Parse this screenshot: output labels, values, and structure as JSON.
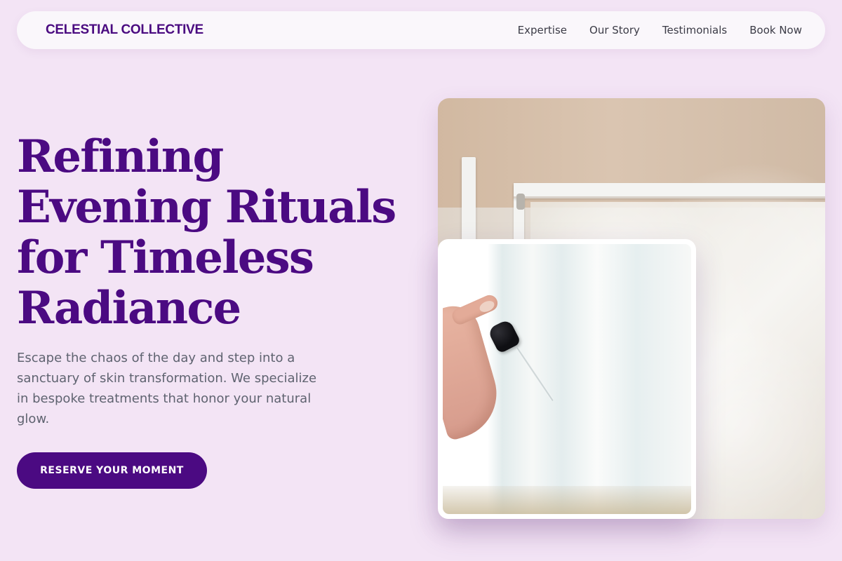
{
  "navigation": {
    "brand": "CELESTIAL COLLECTIVE",
    "links": [
      {
        "label": "Expertise"
      },
      {
        "label": "Our Story"
      },
      {
        "label": "Testimonials"
      },
      {
        "label": "Book Now"
      }
    ]
  },
  "hero": {
    "title": "Refining Evening Rituals for Timeless Radiance",
    "description": "Escape the chaos of the day and step into a sanctuary of skin transformation. We specialize in bespoke treatments that honor your natural glow.",
    "cta_label": "RESERVE YOUR MOMENT"
  },
  "colors": {
    "page_background": "#f3e4f5",
    "brand_purple": "#4b0a82",
    "text_gray": "#5f6370",
    "white": "#ffffff"
  },
  "images": {
    "main_photo_icon": "skincare-rack-photo",
    "inset_photo_icon": "serum-dropper-photo"
  }
}
